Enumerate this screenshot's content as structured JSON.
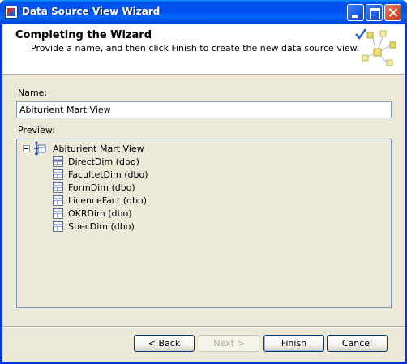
{
  "window": {
    "title": "Data Source View Wizard"
  },
  "header": {
    "title": "Completing the Wizard",
    "subtitle": "Provide a name, and then click Finish to create the new data source view."
  },
  "form": {
    "name_label": "Name:",
    "name_value": "Abiturient Mart View",
    "preview_label": "Preview:"
  },
  "tree": {
    "root": "Abiturient Mart View",
    "items": [
      "DirectDim (dbo)",
      "FacultetDim (dbo)",
      "FormDim (dbo)",
      "LicenceFact (dbo)",
      "OKRDim (dbo)",
      "SpecDim (dbo)"
    ]
  },
  "buttons": {
    "back": "< Back",
    "next": "Next >",
    "finish": "Finish",
    "cancel": "Cancel"
  },
  "colors": {
    "titlebar": "#0053ee",
    "dialog_bg": "#ece9d8",
    "border": "#7f9db9"
  }
}
